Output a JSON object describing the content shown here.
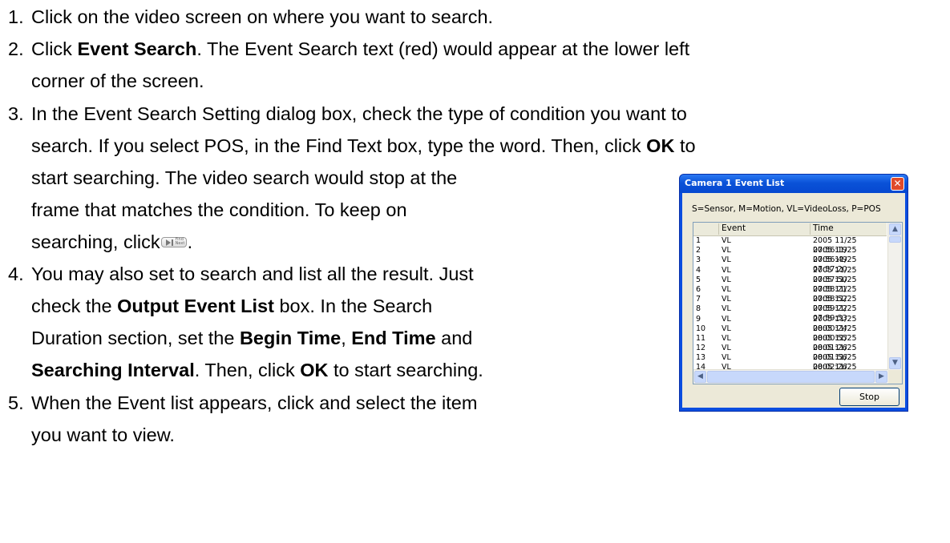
{
  "steps": [
    {
      "num": "1.",
      "pre": "Click on the video screen on where you want to search."
    },
    {
      "num": "2.",
      "pre": "Click ",
      "bold": "Event Search",
      "post": ". The Event Search text (red) would appear at the lower left",
      "cont": "corner of the screen."
    },
    {
      "num": "3.",
      "pre": "In the Event Search Setting dialog box, check the type of condition you want to",
      "l2_pre": "search. If you select POS, in the Find Text box, type the word. Then, click ",
      "l2_bold": "OK",
      "l2_post": " to",
      "l3": "start searching. The video search would stop at the",
      "l4": "frame that matches the condition. To keep on",
      "l5_pre": "searching, click",
      "l5_post": "."
    },
    {
      "num": "4.",
      "pre": "You may also set to search and list all the result. Just",
      "l2_pre": "check the ",
      "l2_bold": "Output Event List",
      "l2_post": " box. In the Search",
      "l3_pre": "Duration section, set the ",
      "l3_b1": "Begin Time",
      "l3_mid": ", ",
      "l3_b2": "End Time",
      "l3_post": " and",
      "l4_bold": "Searching Interval",
      "l4_mid": ". Then, click ",
      "l4_b2": "OK",
      "l4_post": " to start searching."
    },
    {
      "num": "5.",
      "pre": "When the Event list appears, click and select the item",
      "cont": "you want to view."
    }
  ],
  "find_next_icon": {
    "icon": "find-next-icon",
    "label": "Find Next"
  },
  "dialog": {
    "title": "Camera 1  Event List",
    "close_icon": "close-icon",
    "legend": "S=Sensor, M=Motion, VL=VideoLoss, P=POS",
    "columns": [
      "",
      "Event",
      "Time"
    ],
    "rows": [
      {
        "no": "1",
        "event": "VL",
        "time": "2005 11/25 07:56:19"
      },
      {
        "no": "2",
        "event": "VL",
        "time": "2005 11/25 07:56:49"
      },
      {
        "no": "3",
        "event": "VL",
        "time": "2005 11/25 07:57:20"
      },
      {
        "no": "4",
        "event": "VL",
        "time": "2005 11/25 07:57:50"
      },
      {
        "no": "5",
        "event": "VL",
        "time": "2005 11/25 07:58:21"
      },
      {
        "no": "6",
        "event": "VL",
        "time": "2005 11/25 07:58:52"
      },
      {
        "no": "7",
        "event": "VL",
        "time": "2005 11/25 07:59:22"
      },
      {
        "no": "8",
        "event": "VL",
        "time": "2005 11/25 07:59:53"
      },
      {
        "no": "9",
        "event": "VL",
        "time": "2005 11/25 08:00:24"
      },
      {
        "no": "10",
        "event": "VL",
        "time": "2005 11/25 08:00:55"
      },
      {
        "no": "11",
        "event": "VL",
        "time": "2005 11/25 08:01:26"
      },
      {
        "no": "12",
        "event": "VL",
        "time": "2005 11/25 08:01:56"
      },
      {
        "no": "13",
        "event": "VL",
        "time": "2005 11/25 08:02:26"
      },
      {
        "no": "14",
        "event": "VL",
        "time": "2005 11/25 08:02:57"
      }
    ],
    "stop_label": "Stop",
    "scroll_icons": {
      "up": "scroll-up-icon",
      "down": "scroll-down-icon",
      "left": "scroll-left-icon",
      "right": "scroll-right-icon"
    }
  },
  "colors": {
    "title_bar": "#0a52d8",
    "close_button": "#e04a2a",
    "dialog_face": "#ece9d8"
  }
}
